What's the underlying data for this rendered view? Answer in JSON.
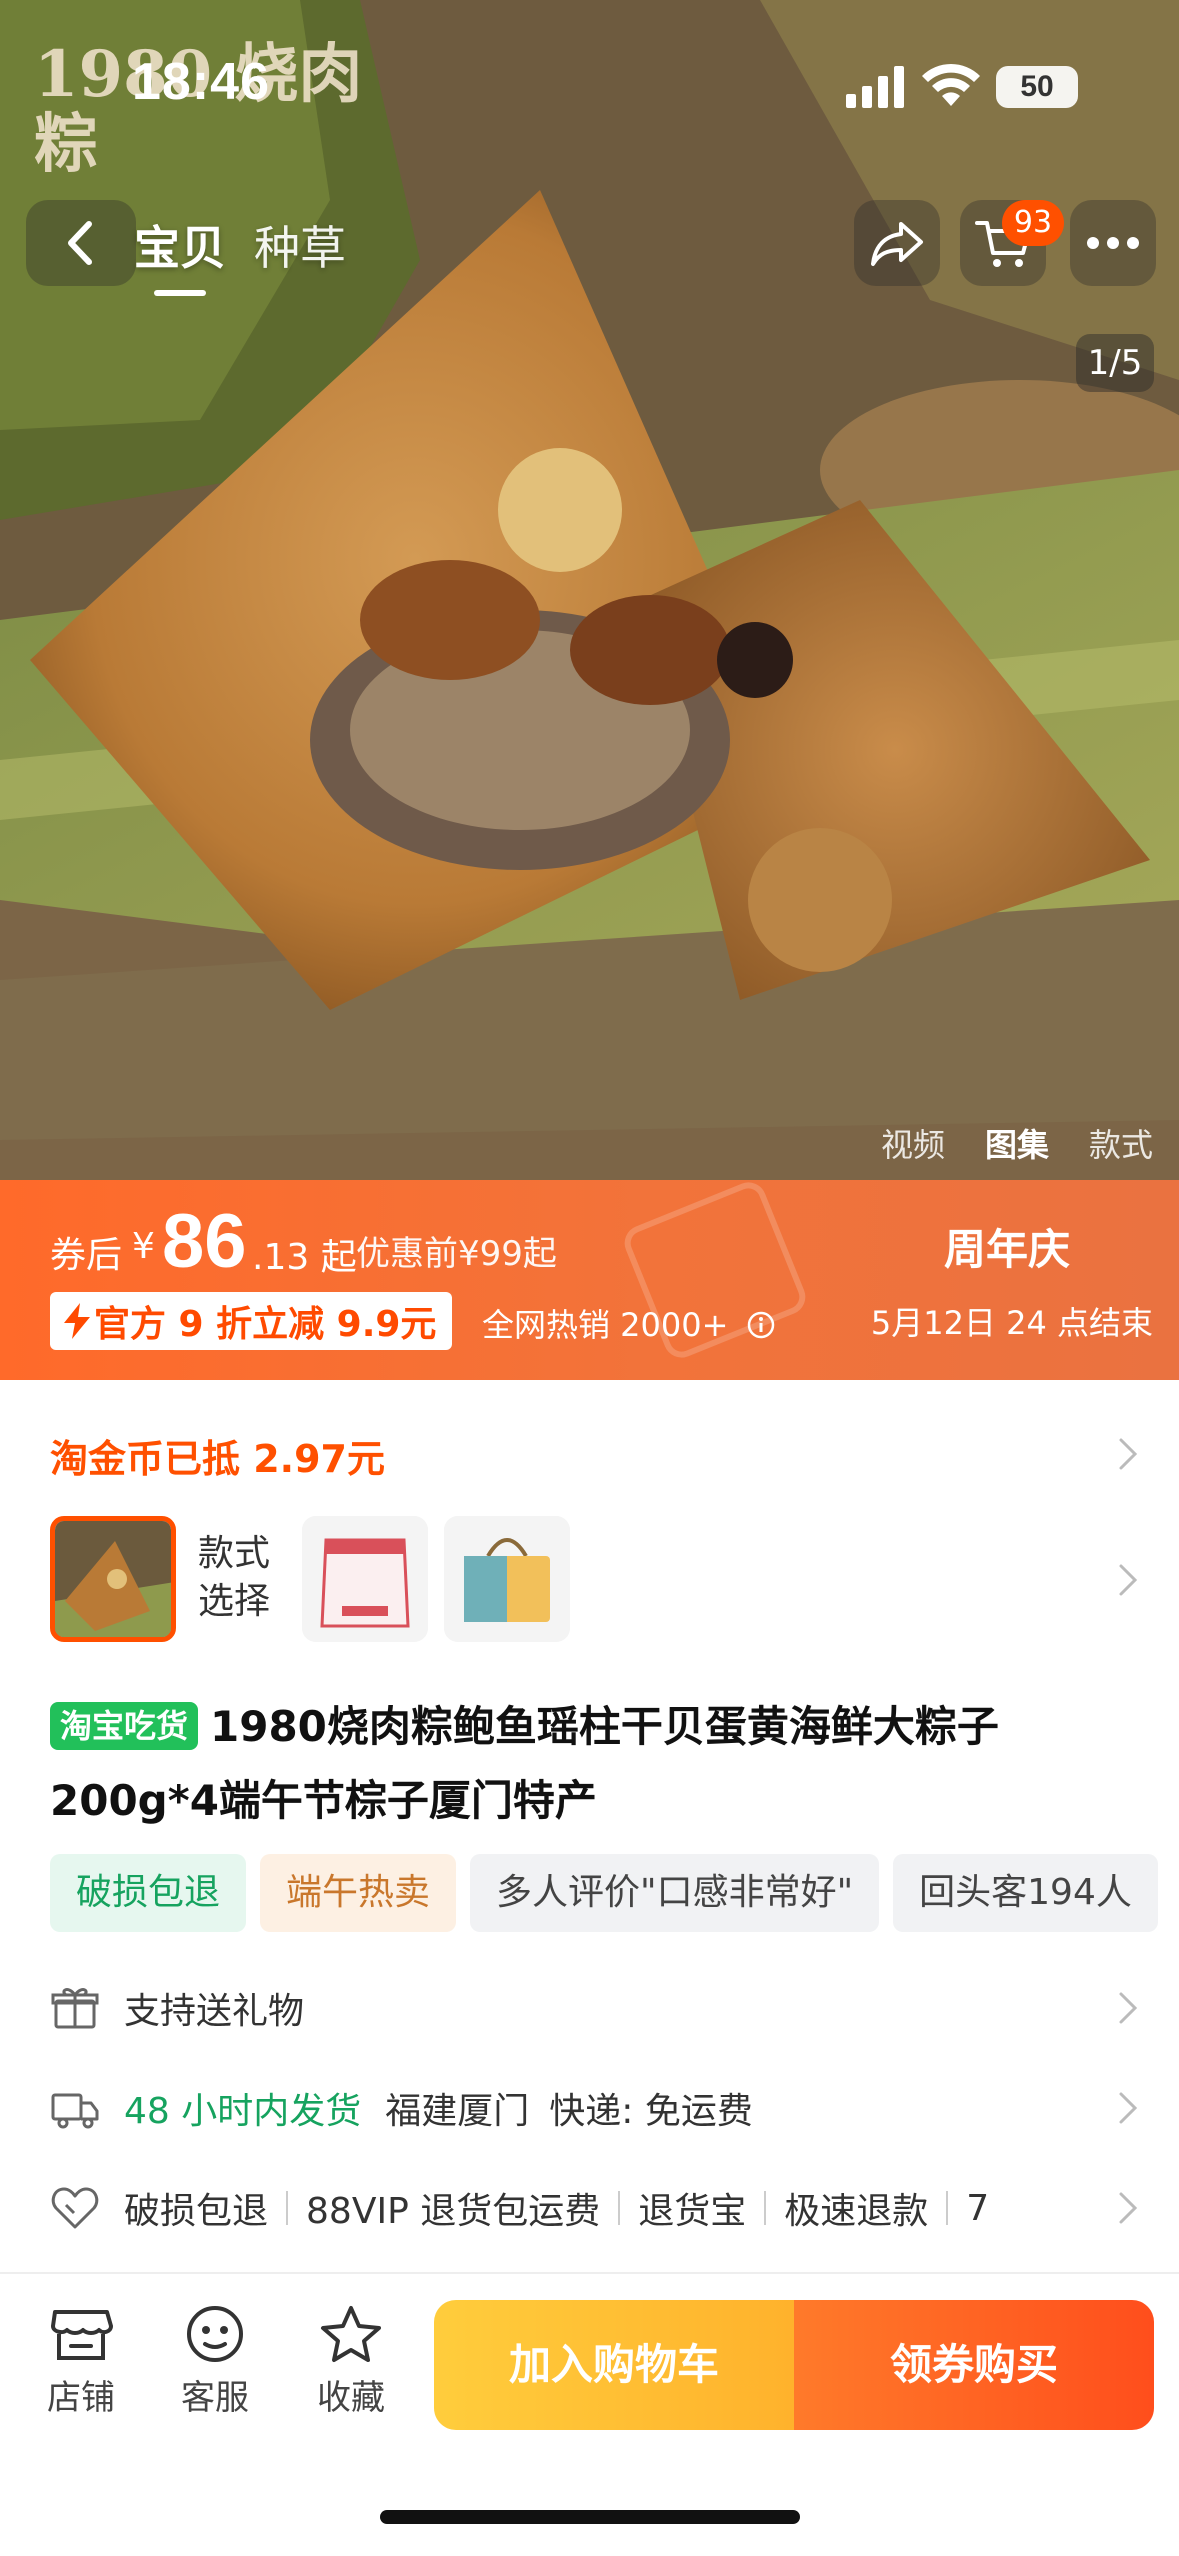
{
  "status_bar": {
    "time": "18:46",
    "battery": "50"
  },
  "hero": {
    "brand_overlay": "1980 烧肉粽",
    "tabs": [
      {
        "label": "宝贝"
      },
      {
        "label": "种草"
      }
    ],
    "cart_count": "93",
    "page_indicator": "1/5",
    "media_tabs": [
      {
        "label": "视频"
      },
      {
        "label": "图集"
      },
      {
        "label": "款式"
      }
    ]
  },
  "price_banner": {
    "after_coupon_label": "券后",
    "currency": "¥",
    "price_int": "86",
    "price_dec": ".13 起",
    "before_discount": "优惠前¥99起",
    "official_discount": "官方 9 折立减 9.9元",
    "sales": "全网热销 2000+",
    "event_title": "周年庆",
    "event_end": "5月12日 24 点结束"
  },
  "coins": {
    "text": "淘金币已抵 2.97元"
  },
  "styles": {
    "label": "款式选择"
  },
  "product": {
    "tag": "淘宝吃货",
    "title": "1980烧肉粽鲍鱼瑶柱干贝蛋黄海鲜大粽子200g*4端午节棕子厦门特产"
  },
  "chips": [
    {
      "label": "破损包退"
    },
    {
      "label": "端午热卖"
    },
    {
      "label": "多人评价\"口感非常好\""
    },
    {
      "label": "回头客194人"
    }
  ],
  "info": {
    "gift": "支持送礼物",
    "ship_time": "48 小时内发货",
    "ship_from": "福建厦门",
    "ship_fee": "快递: 免运费",
    "guarantees": [
      "破损包退",
      "88VIP 退货包运费",
      "退货宝",
      "极速退款",
      "7"
    ]
  },
  "bottom_bar": {
    "store": "店铺",
    "service": "客服",
    "favorite": "收藏",
    "add_cart": "加入购物车",
    "buy": "领券购买"
  },
  "colors": {
    "accent": "#ff5000",
    "green": "#16a35f",
    "banner": "#f2733a"
  }
}
